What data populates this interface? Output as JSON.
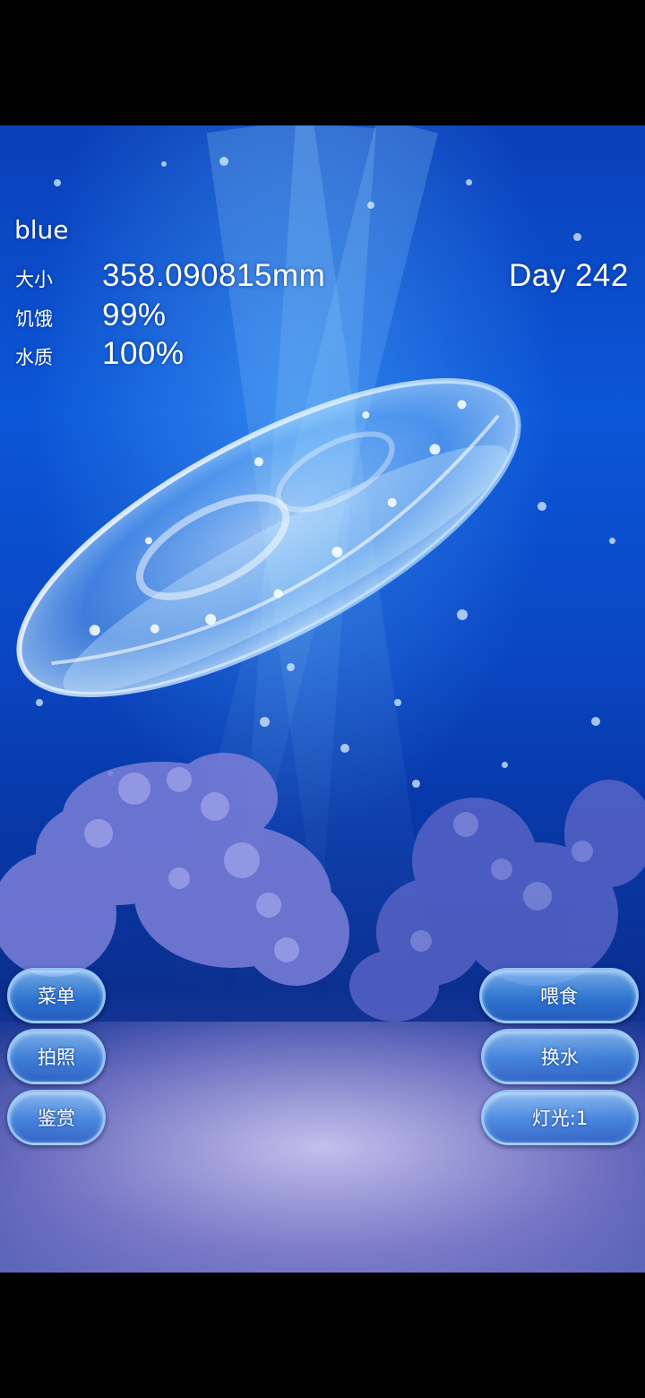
{
  "jellyfish_name": "blue",
  "stats": {
    "size": {
      "label": "大小",
      "value": "358.090815mm"
    },
    "hunger": {
      "label": "饥饿",
      "value": "99%"
    },
    "water": {
      "label": "水质",
      "value": "100%"
    }
  },
  "day": "Day 242",
  "left_buttons": {
    "menu": "菜单",
    "photo": "拍照",
    "appreciate": "鉴赏"
  },
  "right_buttons": {
    "feed": "喂食",
    "change_water": "换水",
    "light": "灯光:1"
  },
  "colors": {
    "water_top": "#0a3fb8",
    "water_mid": "#0b56d8",
    "sand": "#d2cdf5",
    "button_border": "#a0d2ff"
  }
}
